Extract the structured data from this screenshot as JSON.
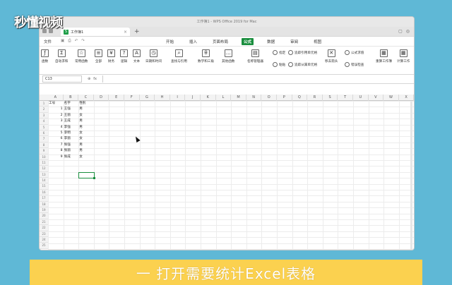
{
  "watermark": "秒懂视频",
  "window": {
    "title": "工作簿1 - WPS Office 2019 for Mac",
    "tab_label": "工作簿1",
    "tab_icon": "spreadsheet-icon"
  },
  "menubar": {
    "file": "文件",
    "menus": [
      "开始",
      "插入",
      "页面布局",
      "公式",
      "数据",
      "审阅",
      "视图"
    ],
    "active": "公式"
  },
  "ribbon": {
    "buttons": [
      "函数",
      "自动求和",
      "常用函数",
      "全部",
      "财务",
      "逻辑",
      "文本",
      "日期和时间",
      "查找与引用",
      "数学和三角",
      "其他函数",
      "名称管理器",
      "计算工作"
    ],
    "small": [
      "指定",
      "粘贴",
      "追踪引用单元格",
      "追踪从属单元格",
      "移去箭头",
      "公式求值",
      "错误检查",
      "重算工作簿"
    ]
  },
  "formula_bar": {
    "name_box": "C13",
    "fx": "fx",
    "value": ""
  },
  "sheet": {
    "columns": [
      "A",
      "B",
      "C",
      "D",
      "E",
      "F",
      "G",
      "H",
      "I",
      "J",
      "K",
      "L",
      "M",
      "N",
      "O",
      "P",
      "Q",
      "R",
      "S",
      "T",
      "U",
      "V",
      "W",
      "X"
    ],
    "rows": [
      "1",
      "2",
      "3",
      "4",
      "5",
      "6",
      "7",
      "8",
      "9",
      "10",
      "11",
      "12",
      "13",
      "14",
      "15",
      "16",
      "17",
      "18",
      "19",
      "20",
      "21",
      "22",
      "23",
      "24",
      "25"
    ],
    "headers": [
      "工号",
      "名字",
      "性别"
    ],
    "data": [
      [
        "1",
        "王强",
        "男"
      ],
      [
        "2",
        "王丽",
        "女"
      ],
      [
        "3",
        "王成",
        "男"
      ],
      [
        "4",
        "李强",
        "男"
      ],
      [
        "5",
        "李明",
        "女"
      ],
      [
        "6",
        "李丽",
        "女"
      ],
      [
        "7",
        "张强",
        "男"
      ],
      [
        "8",
        "张丽",
        "男"
      ],
      [
        "9",
        "张成",
        "女"
      ]
    ],
    "selected_cell": "C13"
  },
  "caption": "一 打开需要统计Excel表格"
}
